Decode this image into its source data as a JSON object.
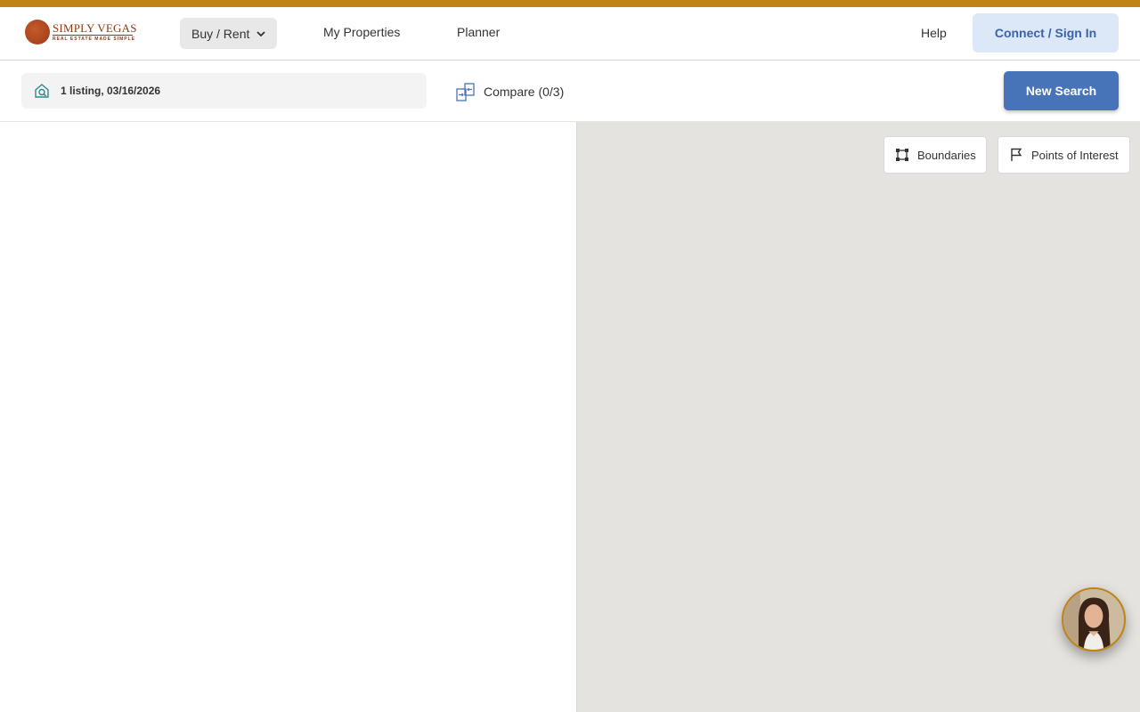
{
  "brand": {
    "name": "SIMPLY VEGAS",
    "tagline": "REAL ESTATE MADE SIMPLE",
    "accent_color": "#c08315",
    "logo_color": "#8a3a16"
  },
  "nav": {
    "buy_rent": "Buy / Rent",
    "my_properties": "My Properties",
    "planner": "Planner",
    "help": "Help",
    "sign_in": "Connect / Sign In"
  },
  "toolbar": {
    "search_summary": "1 listing, 03/16/2026",
    "compare": "Compare (0/3)",
    "new_search": "New Search",
    "primary_color": "#4774b8"
  },
  "map": {
    "boundaries": "Boundaries",
    "points_of_interest": "Points of Interest",
    "background_color": "#e5e3df"
  },
  "icons": {
    "search": "house-search-icon",
    "compare": "compare-icon",
    "boundaries": "boundaries-icon",
    "poi": "flag-icon",
    "dropdown": "chevron-down-icon"
  }
}
